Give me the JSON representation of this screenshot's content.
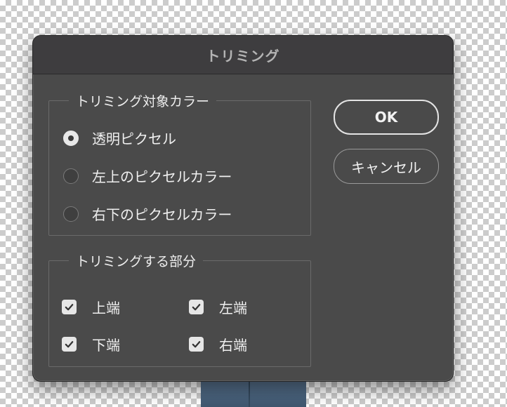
{
  "dialog": {
    "title": "トリミング"
  },
  "trim_target": {
    "legend": "トリミング対象カラー",
    "options": [
      {
        "label": "透明ピクセル",
        "selected": true
      },
      {
        "label": "左上のピクセルカラー",
        "selected": false
      },
      {
        "label": "右下のピクセルカラー",
        "selected": false
      }
    ]
  },
  "trim_away": {
    "legend": "トリミングする部分",
    "checkboxes": [
      {
        "label": "上端",
        "checked": true
      },
      {
        "label": "左端",
        "checked": true
      },
      {
        "label": "下端",
        "checked": true
      },
      {
        "label": "右端",
        "checked": true
      }
    ]
  },
  "buttons": {
    "ok_label": "OK",
    "cancel_label": "キャンセル"
  },
  "icons": {
    "check": "checkmark-icon",
    "radio_selected": "radio-selected-icon",
    "radio_unselected": "radio-unselected-icon"
  },
  "colors": {
    "dialog_bg": "#4a4a4a",
    "titlebar_bg": "#3e3d3f",
    "title_text": "#b4b4b4",
    "text": "#f0f0f0",
    "control_fill": "#e6e6e6"
  }
}
